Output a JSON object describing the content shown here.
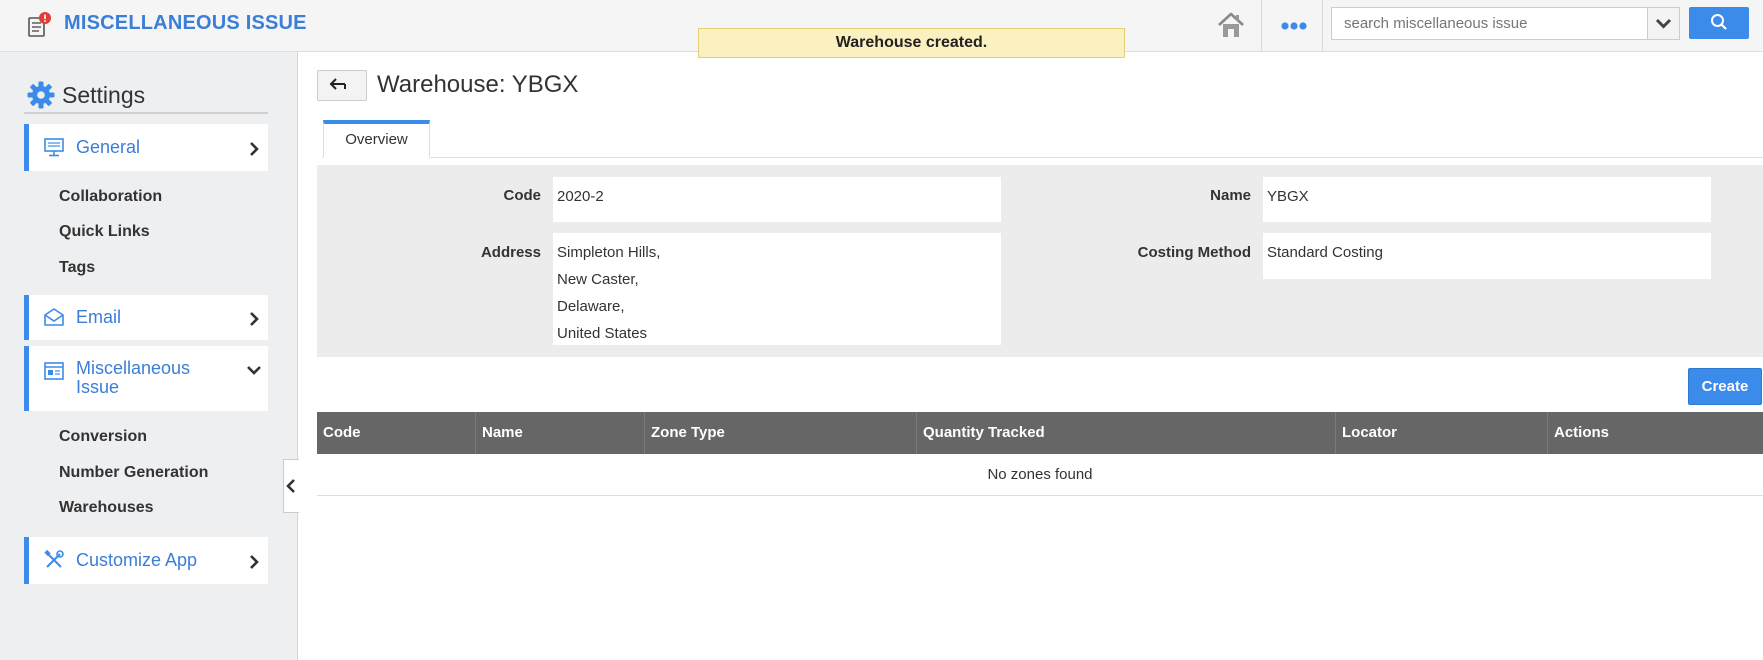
{
  "header": {
    "app_title": "MISCELLANEOUS ISSUE",
    "toast": "Warehouse created.",
    "search_placeholder": "search miscellaneous issue"
  },
  "sidebar": {
    "title": "Settings",
    "sections": [
      {
        "label": "General",
        "icon": "monitor-icon",
        "expanded": false,
        "items": [
          "Collaboration",
          "Quick Links",
          "Tags"
        ]
      },
      {
        "label": "Email",
        "icon": "envelope-icon",
        "expanded": false,
        "items": []
      },
      {
        "label": "Miscellaneous Issue",
        "icon": "window-icon",
        "expanded": true,
        "items": [
          "Conversion",
          "Number Generation",
          "Warehouses"
        ]
      },
      {
        "label": "Customize App",
        "icon": "tools-icon",
        "expanded": false,
        "items": []
      }
    ]
  },
  "main": {
    "title": "Warehouse: YBGX",
    "tabs": [
      {
        "label": "Overview",
        "active": true
      }
    ],
    "fields": {
      "code_label": "Code",
      "code_value": "2020-2",
      "name_label": "Name",
      "name_value": "YBGX",
      "address_label": "Address",
      "address_lines": [
        "Simpleton Hills,",
        "New Caster,",
        "Delaware,",
        "United States"
      ],
      "costing_label": "Costing Method",
      "costing_value": "Standard Costing"
    },
    "create_label": "Create",
    "zones_table": {
      "columns": [
        "Code",
        "Name",
        "Zone Type",
        "Quantity Tracked",
        "Locator",
        "Actions"
      ],
      "empty_message": "No zones found"
    }
  },
  "colors": {
    "accent": "#3b8beb",
    "title_blue": "#3b7ed8",
    "table_header": "#666666",
    "toast_bg": "#fbf0c0",
    "badge_red": "#e53935"
  }
}
